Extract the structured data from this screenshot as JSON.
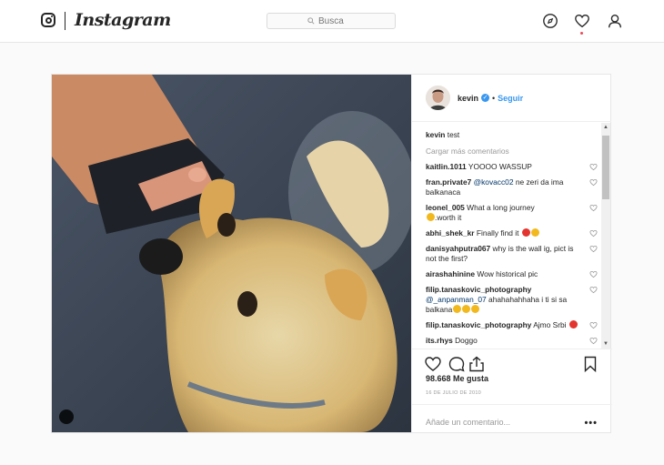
{
  "header": {
    "brand": "Instagram",
    "search_placeholder": "Busca"
  },
  "post": {
    "author": "kevin",
    "follow_label": "Seguir",
    "separator": "•",
    "caption_user": "kevin",
    "caption_text": "test",
    "load_more": "Cargar más comentarios",
    "comments": [
      {
        "user": "kaitlin.1011",
        "text": "YOOOO WASSUP"
      },
      {
        "user": "fran.private7",
        "mention": "@kovacc02",
        "text": "ne zeri da ima balkanaca"
      },
      {
        "user": "leonel_005",
        "text": "What a long journey",
        "text2": ".worth it"
      },
      {
        "user": "abhi_shek_kr",
        "text": "Finally find it"
      },
      {
        "user": "danisyahputra067",
        "text": "why is the wall ig, pict is not the first?"
      },
      {
        "user": "airashahinine",
        "text": "Wow historical pic"
      },
      {
        "user": "filip.tanaskovic_photography",
        "mention": "@_anpanman_07",
        "text": "ahahahahhaha i ti si sa balkana"
      },
      {
        "user": "filip.tanaskovic_photography",
        "text": "Ajmo Srbi"
      },
      {
        "user": "its.rhys",
        "text": "Doggo"
      }
    ],
    "likes": "98.668 Me gusta",
    "date": "16 DE JULIO DE 2010",
    "add_comment_placeholder": "Añade un comentario...",
    "more_label": "•••"
  },
  "icons": {
    "nav": [
      "explore-icon",
      "heart-icon",
      "profile-icon"
    ],
    "actions": [
      "like-icon",
      "comment-icon",
      "share-icon",
      "bookmark-icon"
    ]
  },
  "colors": {
    "link": "#3897f0",
    "notification": "#ed4956"
  }
}
